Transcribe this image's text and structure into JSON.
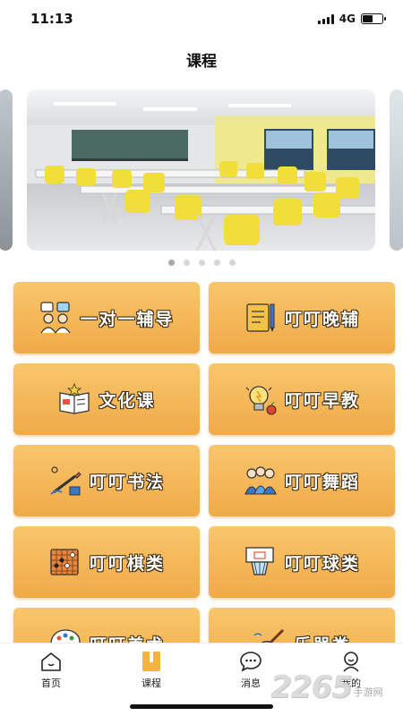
{
  "status_bar": {
    "time": "11:13",
    "network": "4G",
    "battery_level": 0.55
  },
  "header": {
    "title": "课程"
  },
  "banner": {
    "image": "classroom-photo",
    "page_count": 5,
    "active_index": 0
  },
  "courses": [
    {
      "label": "一对一辅导",
      "icon": "tutoring-icon"
    },
    {
      "label": "叮叮晚辅",
      "icon": "notebook-pen-icon"
    },
    {
      "label": "文化课",
      "icon": "open-book-icon"
    },
    {
      "label": "叮叮早教",
      "icon": "lightbulb-icon"
    },
    {
      "label": "叮叮书法",
      "icon": "brush-icon"
    },
    {
      "label": "叮叮舞蹈",
      "icon": "dancers-icon"
    },
    {
      "label": "叮叮棋类",
      "icon": "go-board-icon"
    },
    {
      "label": "叮叮球类",
      "icon": "basketball-hoop-icon"
    },
    {
      "label": "叮叮美术",
      "icon": "palette-icon"
    },
    {
      "label": "乐器类",
      "icon": "guitar-icon"
    }
  ],
  "tabbar": {
    "tabs": [
      {
        "label": "首页",
        "icon": "home-icon"
      },
      {
        "label": "课程",
        "icon": "course-book-icon",
        "active": true
      },
      {
        "label": "消息",
        "icon": "chat-bubble-icon"
      },
      {
        "label": "我的",
        "icon": "profile-icon"
      }
    ]
  },
  "watermark": {
    "number": "2265",
    "text": "手游网"
  },
  "colors": {
    "card_top": "#f9c66c",
    "card_bottom": "#f0aa48",
    "active_tab": "#f3b33e",
    "label_outline": "#3a2a10"
  }
}
